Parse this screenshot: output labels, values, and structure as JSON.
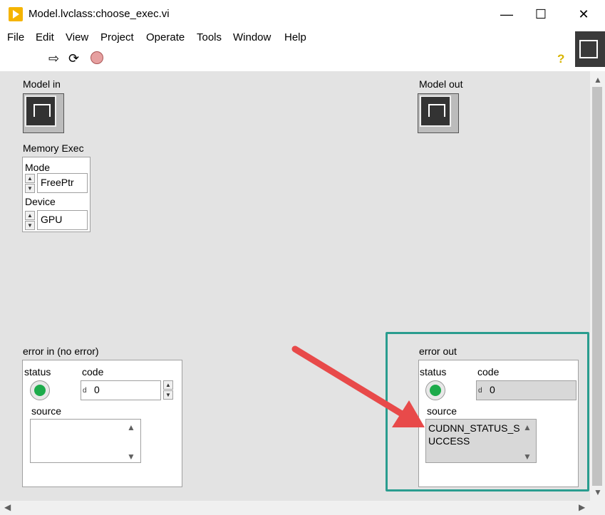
{
  "window": {
    "title": "Model.lvclass:choose_exec.vi"
  },
  "menu": [
    "File",
    "Edit",
    "View",
    "Project",
    "Operate",
    "Tools",
    "Window",
    "Help"
  ],
  "toolbar": {
    "run": "⇨",
    "run_continuously": "⟳",
    "abort": "●",
    "help": "?"
  },
  "panel": {
    "model_in": {
      "label": "Model in"
    },
    "model_out": {
      "label": "Model out"
    },
    "memory_exec": {
      "label": "Memory Exec",
      "mode_label": "Mode",
      "mode_value": "FreePtr",
      "device_label": "Device",
      "device_value": "GPU"
    },
    "error_in": {
      "label": "error in (no error)",
      "status_label": "status",
      "code_label": "code",
      "code_value": "0",
      "radix": "d",
      "source_label": "source",
      "source_value": ""
    },
    "error_out": {
      "label": "error out",
      "status_label": "status",
      "code_label": "code",
      "code_value": "0",
      "radix": "d",
      "source_label": "source",
      "source_line1": "CUDNN_STATUS_S",
      "source_line2": "UCCESS"
    }
  },
  "colors": {
    "led_on": "#1dab4b",
    "highlight_box": "#2a9d8f",
    "annotation_arrow": "#e84a4a",
    "panel_bg": "#e3e3e3"
  }
}
